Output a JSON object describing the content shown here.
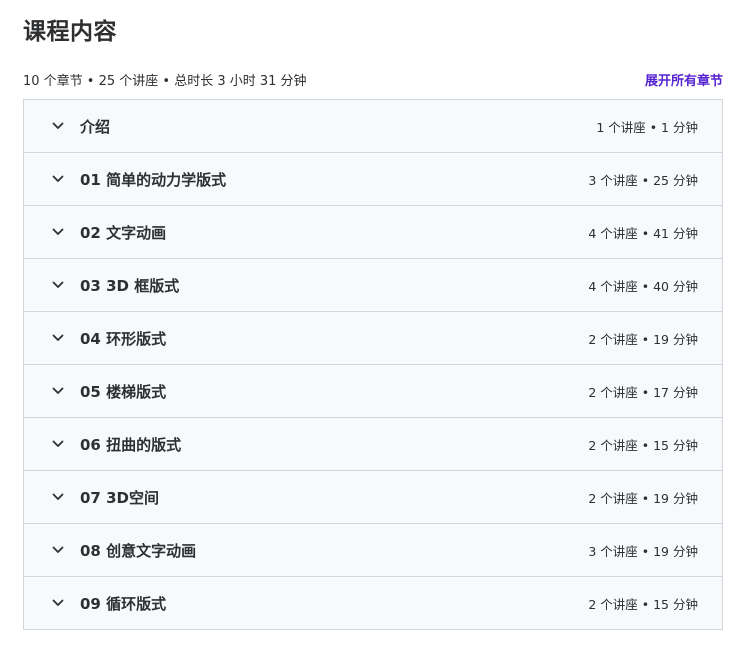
{
  "header": {
    "title": "课程内容",
    "summary": "10 个章节 • 25 个讲座 • 总时长 3 小时 31 分钟",
    "expand_all": "展开所有章节"
  },
  "colors": {
    "accent": "#5624d0",
    "section_bg": "#f7f9fa",
    "border": "#d1d7dc",
    "text": "#2d2f31"
  },
  "sections": [
    {
      "title": "介绍",
      "meta": "1 个讲座 • 1 分钟",
      "icon": "chevron-down-icon"
    },
    {
      "title": "01 简单的动力学版式",
      "meta": "3 个讲座 • 25 分钟",
      "icon": "chevron-down-icon"
    },
    {
      "title": "02 文字动画",
      "meta": "4 个讲座 • 41 分钟",
      "icon": "chevron-down-icon"
    },
    {
      "title": "03 3D 框版式",
      "meta": "4 个讲座 • 40 分钟",
      "icon": "chevron-down-icon"
    },
    {
      "title": "04 环形版式",
      "meta": "2 个讲座 • 19 分钟",
      "icon": "chevron-down-icon"
    },
    {
      "title": "05 楼梯版式",
      "meta": "2 个讲座 • 17 分钟",
      "icon": "chevron-down-icon"
    },
    {
      "title": "06 扭曲的版式",
      "meta": "2 个讲座 • 15 分钟",
      "icon": "chevron-down-icon"
    },
    {
      "title": "07 3D空间",
      "meta": "2 个讲座 • 19 分钟",
      "icon": "chevron-down-icon"
    },
    {
      "title": "08 创意文字动画",
      "meta": "3 个讲座 • 19 分钟",
      "icon": "chevron-down-icon"
    },
    {
      "title": "09 循环版式",
      "meta": "2 个讲座 • 15 分钟",
      "icon": "chevron-down-icon"
    }
  ]
}
